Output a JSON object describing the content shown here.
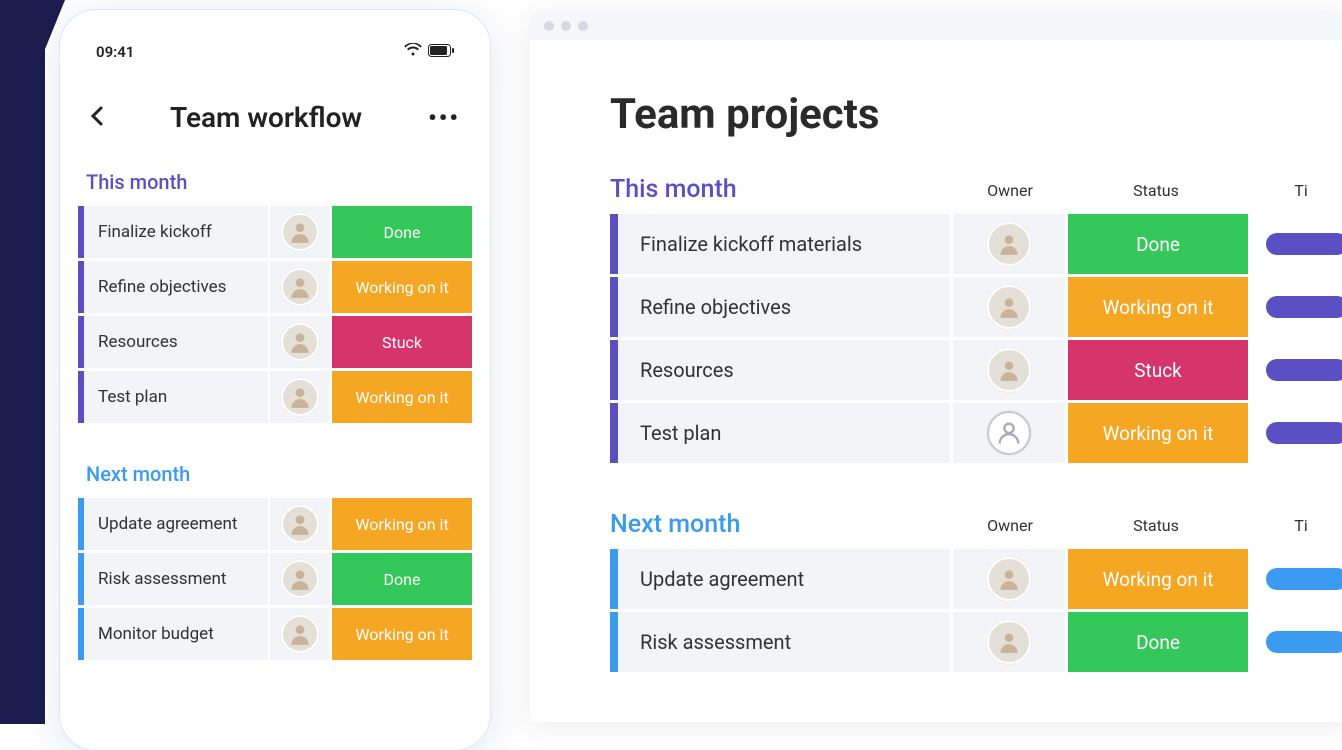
{
  "phone": {
    "time": "09:41",
    "title": "Team workflow",
    "groups": [
      {
        "title": "This month",
        "color": "purple",
        "tasks": [
          {
            "name": "Finalize kickoff",
            "status": "Done",
            "status_class": "done"
          },
          {
            "name": "Refine objectives",
            "status": "Working on it",
            "status_class": "working"
          },
          {
            "name": "Resources",
            "status": "Stuck",
            "status_class": "stuck"
          },
          {
            "name": "Test plan",
            "status": "Working on it",
            "status_class": "working"
          }
        ]
      },
      {
        "title": "Next month",
        "color": "blue",
        "tasks": [
          {
            "name": "Update agreement",
            "status": "Working on it",
            "status_class": "working"
          },
          {
            "name": "Risk assessment",
            "status": "Done",
            "status_class": "done"
          },
          {
            "name": "Monitor budget",
            "status": "Working on it",
            "status_class": "working"
          }
        ]
      }
    ]
  },
  "browser": {
    "title": "Team projects",
    "columns": {
      "owner": "Owner",
      "status": "Status",
      "time": "Ti"
    },
    "groups": [
      {
        "title": "This month",
        "color": "purple",
        "tasks": [
          {
            "name": "Finalize kickoff materials",
            "status": "Done",
            "status_class": "done",
            "owner_empty": false
          },
          {
            "name": "Refine objectives",
            "status": "Working on it",
            "status_class": "working",
            "owner_empty": false
          },
          {
            "name": "Resources",
            "status": "Stuck",
            "status_class": "stuck",
            "owner_empty": false
          },
          {
            "name": "Test plan",
            "status": "Working on it",
            "status_class": "working",
            "owner_empty": true
          }
        ]
      },
      {
        "title": "Next month",
        "color": "blue",
        "tasks": [
          {
            "name": "Update agreement",
            "status": "Working on it",
            "status_class": "working",
            "owner_empty": false
          },
          {
            "name": "Risk assessment",
            "status": "Done",
            "status_class": "done",
            "owner_empty": false
          }
        ]
      }
    ]
  }
}
